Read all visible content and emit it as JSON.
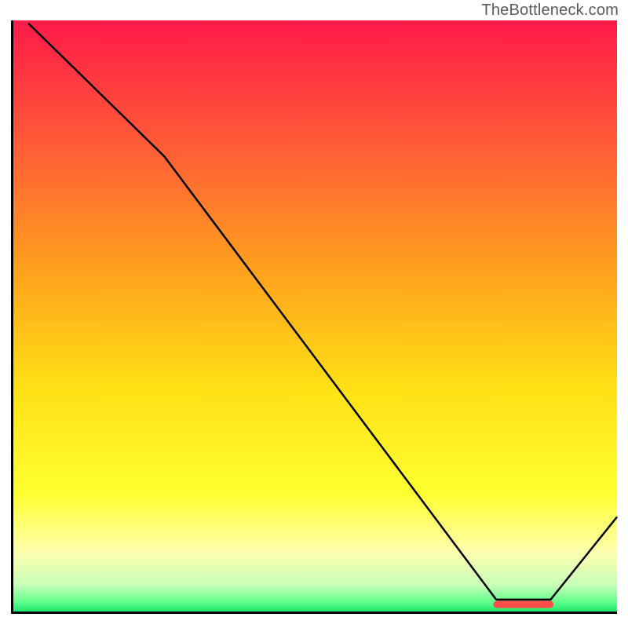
{
  "watermark": "TheBottleneck.com",
  "chart_data": {
    "type": "line",
    "title": "",
    "xlabel": "",
    "ylabel": "",
    "xlim": [
      0,
      100
    ],
    "ylim": [
      0,
      100
    ],
    "background": {
      "type": "vertical_gradient",
      "stops": [
        {
          "pos": 0.0,
          "color": "#ff1a4a"
        },
        {
          "pos": 0.2,
          "color": "#ff5838"
        },
        {
          "pos": 0.42,
          "color": "#ffa01e"
        },
        {
          "pos": 0.62,
          "color": "#ffe015"
        },
        {
          "pos": 0.8,
          "color": "#ffff30"
        },
        {
          "pos": 0.9,
          "color": "#ffffb0"
        },
        {
          "pos": 0.955,
          "color": "#c8ffb8"
        },
        {
          "pos": 0.985,
          "color": "#5eff8a"
        },
        {
          "pos": 1.0,
          "color": "#1ee66a"
        }
      ]
    },
    "series": [
      {
        "name": "curve",
        "color": "#000000",
        "width": 2.5,
        "points": [
          {
            "x": 2.5,
            "y": 99.5
          },
          {
            "x": 25.0,
            "y": 77.0
          },
          {
            "x": 80.0,
            "y": 2.0
          },
          {
            "x": 89.0,
            "y": 2.0
          },
          {
            "x": 100.0,
            "y": 16.0
          }
        ]
      }
    ],
    "markers": [
      {
        "name": "optimal-range-bar",
        "type": "horizontal_bar",
        "color": "#ff4a4a",
        "y": 1.2,
        "x0": 79.5,
        "x1": 89.5,
        "height": 1.2
      }
    ]
  }
}
